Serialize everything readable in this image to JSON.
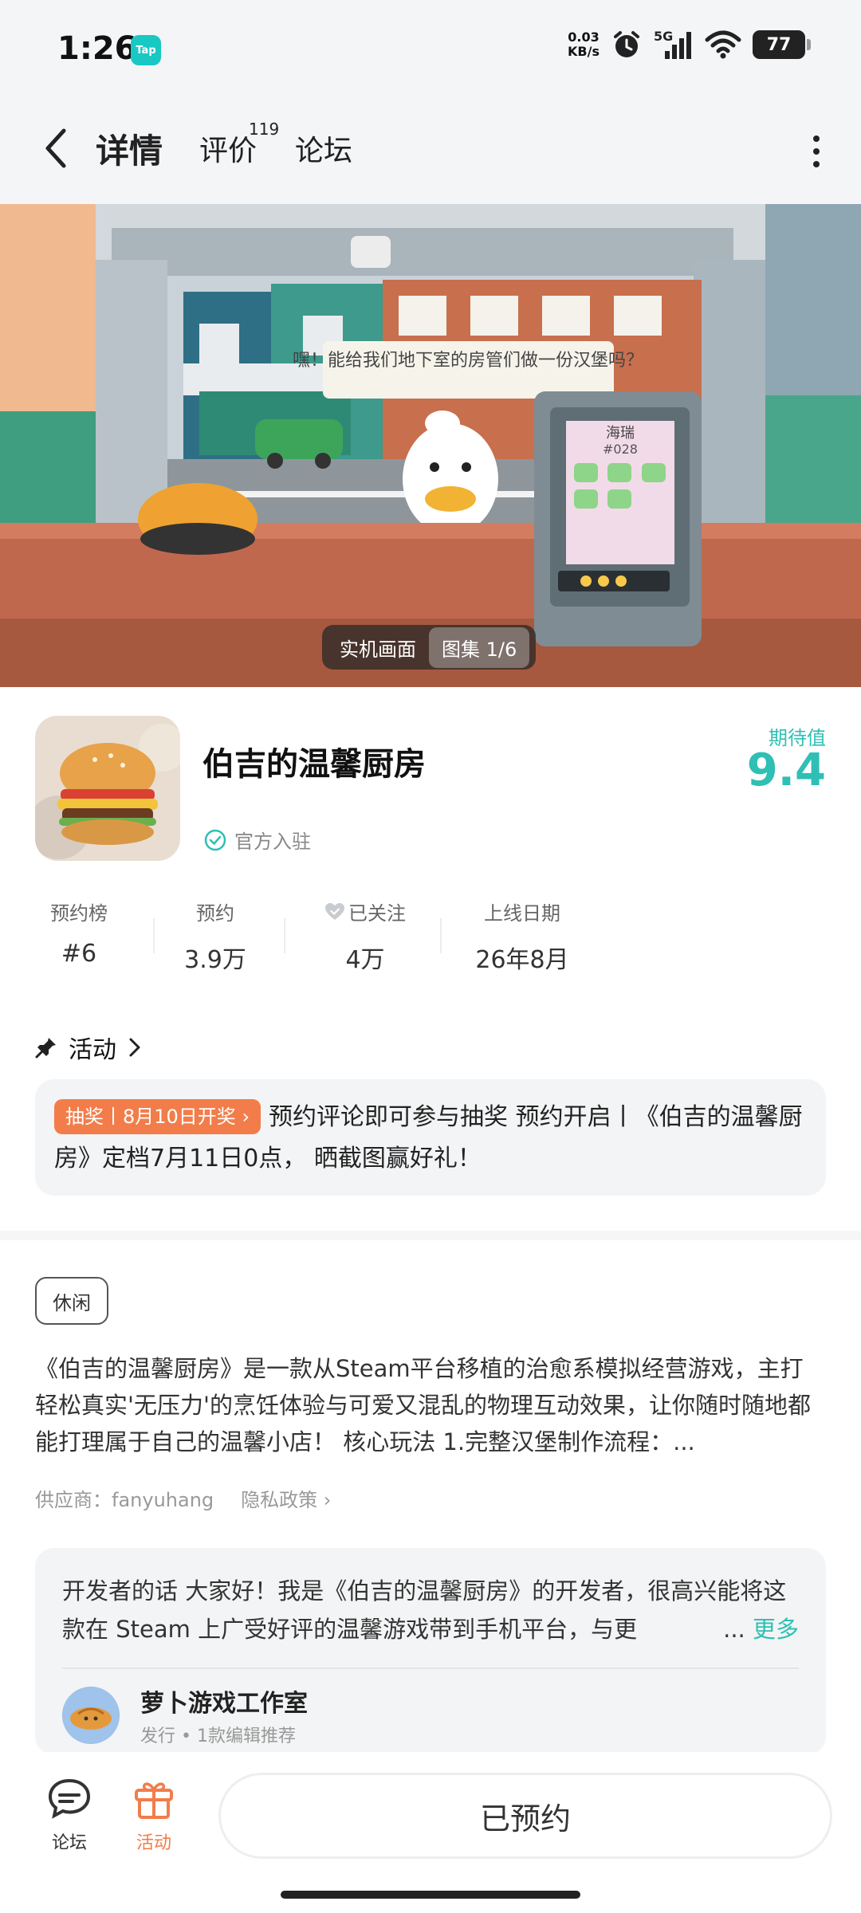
{
  "status_bar": {
    "time": "1:26",
    "app_badge": "Tap",
    "net_speed_value": "0.03",
    "net_speed_unit": "KB/s",
    "network": "5G",
    "battery": "77"
  },
  "nav": {
    "tabs": [
      {
        "label": "详情",
        "active": true
      },
      {
        "label": "评价",
        "count": "119"
      },
      {
        "label": "论坛"
      }
    ]
  },
  "hero": {
    "speech_bubble": "嘿！能给我们地下室的房管们做一份汉堡吗？",
    "screen_title": "海瑞",
    "screen_code": "#028",
    "chip_label": "实机画面",
    "gallery_label": "图集 1/6"
  },
  "game": {
    "title": "伯吉的温馨厨房",
    "official_label": "官方入驻",
    "expect_label": "期待值",
    "expect_score": "9.4",
    "stats": [
      {
        "key": "预约榜",
        "value": "#6"
      },
      {
        "key": "预约",
        "value": "3.9万"
      },
      {
        "key": "已关注",
        "value": "4万",
        "icon": "heart-check-icon"
      },
      {
        "key": "上线日期",
        "value": "26年8月"
      }
    ]
  },
  "activity": {
    "header": "活动",
    "tag": "抽奖丨8月10日开奖",
    "text": "预约评论即可参与抽奖 预约开启丨《伯吉的温馨厨房》定档7月11日0点， 晒截图赢好礼！"
  },
  "details": {
    "genre": "休闲",
    "description": "《伯吉的温馨厨房》是一款从Steam平台移植的治愈系模拟经营游戏，主打轻松真实'无压力'的烹饪体验与可爱又混乱的物理互动效果，让你随时随地都能打理属于自己的温馨小店！ 核心玩法 1.完整汉堡制作流程：...",
    "supplier": "供应商：fanyuhang",
    "privacy": "隐私政策"
  },
  "developer": {
    "words": "开发者的话  大家好！我是《伯吉的温馨厨房》的开发者，很高兴能将这款在 Steam 上广受好评的温馨游戏带到手机平台，与更",
    "ellipsis": "...",
    "more": "更多",
    "studio_name": "萝卜游戏工作室",
    "studio_sub": "发行 • 1款编辑推荐"
  },
  "bottom_bar": {
    "forum": "论坛",
    "activity": "活动",
    "reserve": "已预约"
  },
  "colors": {
    "accent": "#2fbfb4",
    "tag_orange": "#f27d4a",
    "card_bg": "#f3f4f5"
  }
}
